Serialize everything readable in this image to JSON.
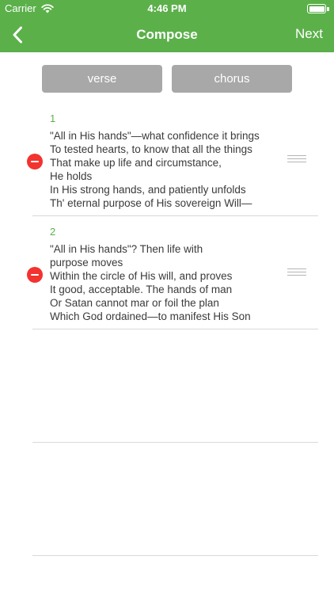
{
  "status_bar": {
    "carrier": "Carrier",
    "time": "4:46 PM"
  },
  "nav": {
    "back_icon": "chevron-left-icon",
    "title": "Compose",
    "next_label": "Next"
  },
  "segments": {
    "verse_label": "verse",
    "chorus_label": "chorus"
  },
  "verses": [
    {
      "number": "1",
      "text": "\"All in His hands\"—what confidence it brings\nTo tested hearts, to know that all the things\nThat make up life and circumstance,\nHe holds\nIn His strong hands, and patiently unfolds\nTh' eternal purpose of His sovereign Will—"
    },
    {
      "number": "2",
      "text": "\"All in His hands\"? Then life with\npurpose moves\nWithin the circle of His will, and proves\nIt good, acceptable. The hands of man\nOr Satan cannot mar or foil the plan\nWhich God ordained—to manifest His Son"
    }
  ],
  "colors": {
    "accent": "#5bb04a",
    "segment_bg": "#a8a8a8",
    "delete": "#f2332f"
  }
}
